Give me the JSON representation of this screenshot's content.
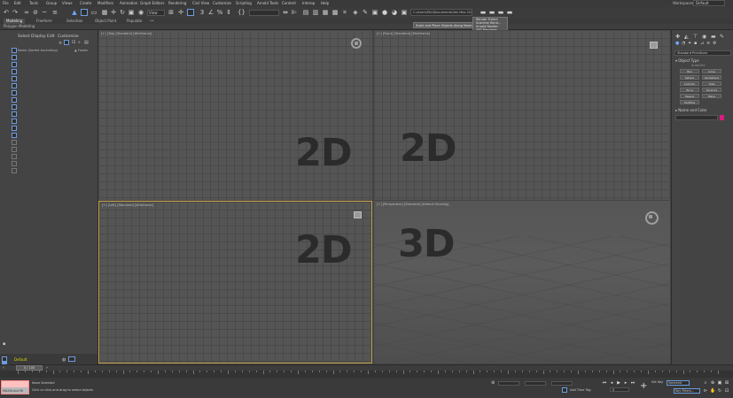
{
  "menu": {
    "items": [
      "File",
      "Edit",
      "Tools",
      "Group",
      "Views",
      "Create",
      "Modifiers",
      "Animation",
      "Graph Editors",
      "Rendering",
      "Civil View",
      "Customize",
      "Scripting",
      "Arnold Tools",
      "Content",
      "Interop",
      "Help"
    ],
    "workspaces_label": "Workspaces:",
    "workspaces_value": "Default"
  },
  "toolbar": {
    "view_dropdown": "View",
    "project_path": "C:\\Users\\PAU\\Documents\\3ds Max 2024",
    "tooltip": "Scale and Place Objects Along Normal",
    "popup_items": [
      "Render Frame",
      "Scanline Rend...",
      "Arnold Render",
      "ART Renderer",
      "Quicksilver"
    ]
  },
  "ribbon": {
    "tabs": [
      "Modeling",
      "Freeform",
      "Selection",
      "Object Paint",
      "Populate",
      "••"
    ],
    "sub_label": "Polygon Modeling"
  },
  "explorer": {
    "tabs": [
      "Select",
      "Display",
      "Edit",
      "Customize"
    ],
    "header_name": "Name (Sorted Ascending)",
    "header_frozen": "▲ Frozen",
    "layer": "Default",
    "layer_field": "0 / 100"
  },
  "viewports": {
    "top": {
      "label": "[+] [Top] [Standard] [Wireframe]",
      "overlay": "2D"
    },
    "front": {
      "label": "[+] [Front] [Standard] [Wireframe]",
      "overlay": "2D"
    },
    "left": {
      "label": "[+] [Left] [Standard] [Wireframe]",
      "overlay": "2D"
    },
    "perspective": {
      "label": "[+] [Perspective] [Standard] [Default Shading]",
      "overlay": "3D"
    }
  },
  "command_panel": {
    "category": "Standard Primitives",
    "object_type_title": "▾ Object Type",
    "autogrid": "AutoGrid",
    "buttons": [
      "Box",
      "Cone",
      "Sphere",
      "GeoSphere",
      "Cylinder",
      "Tube",
      "Torus",
      "Pyramid",
      "Teapot",
      "Plane",
      "TextPlus"
    ],
    "name_color_title": "▸ Name and Color"
  },
  "timeline": {
    "slider": "0 / 100"
  },
  "status": {
    "maxscript": "MAXScript Mi",
    "line1": "None Selected",
    "line2": "Click or click-and-drag to select objects",
    "add_time_tag": "Add Time Tag",
    "set_key": "Set Key",
    "auto_key": "Selected",
    "key_filters": "Key Filters...",
    "frame": "0"
  }
}
